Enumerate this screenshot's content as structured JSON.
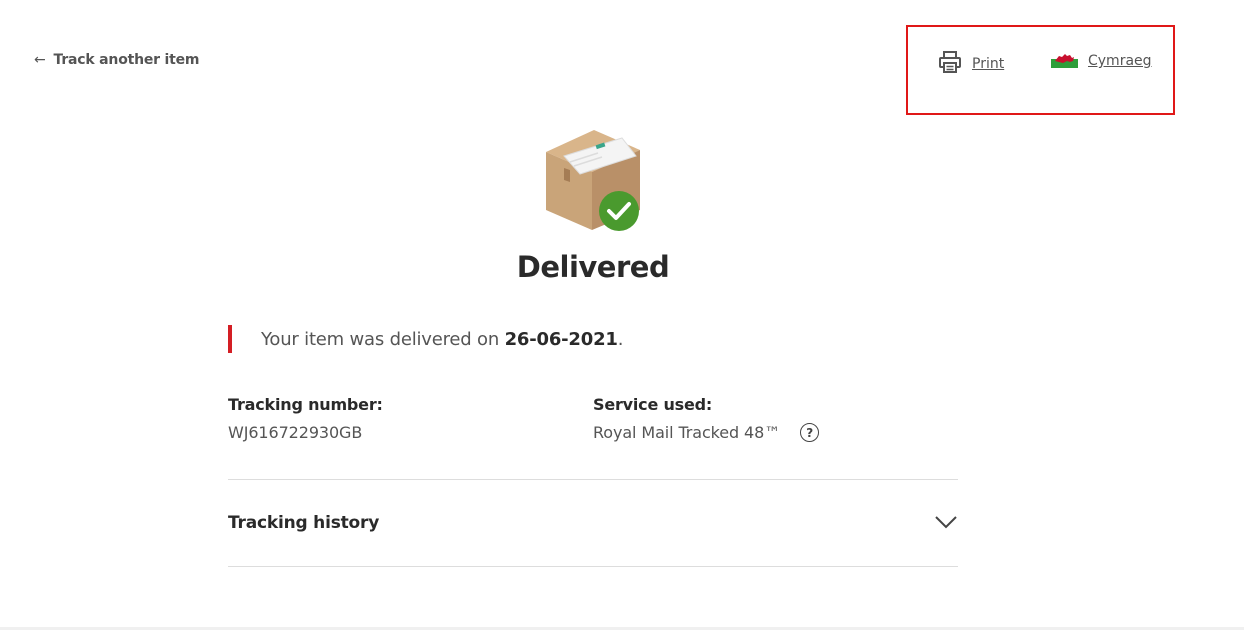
{
  "nav": {
    "back_label": "Track another item",
    "print_label": "Print",
    "language_label": "Cymraeg"
  },
  "status": {
    "title": "Delivered",
    "message_prefix": "Your item was delivered on ",
    "delivered_date": "26-06-2021",
    "message_suffix": "."
  },
  "details": {
    "tracking_number_label": "Tracking number:",
    "tracking_number": "WJ616722930GB",
    "service_label": "Service used:",
    "service_value": "Royal Mail Tracked 48™",
    "help_glyph": "?"
  },
  "history": {
    "label": "Tracking history"
  },
  "colors": {
    "accent_red": "#d41e24",
    "highlight_box": "#e01818",
    "success_green": "#4a9a2e",
    "welsh_green": "#2e9e3a"
  },
  "icons": [
    "left-arrow-icon",
    "printer-icon",
    "welsh-flag-icon",
    "parcel-delivered-icon",
    "help-icon",
    "chevron-down-icon"
  ]
}
